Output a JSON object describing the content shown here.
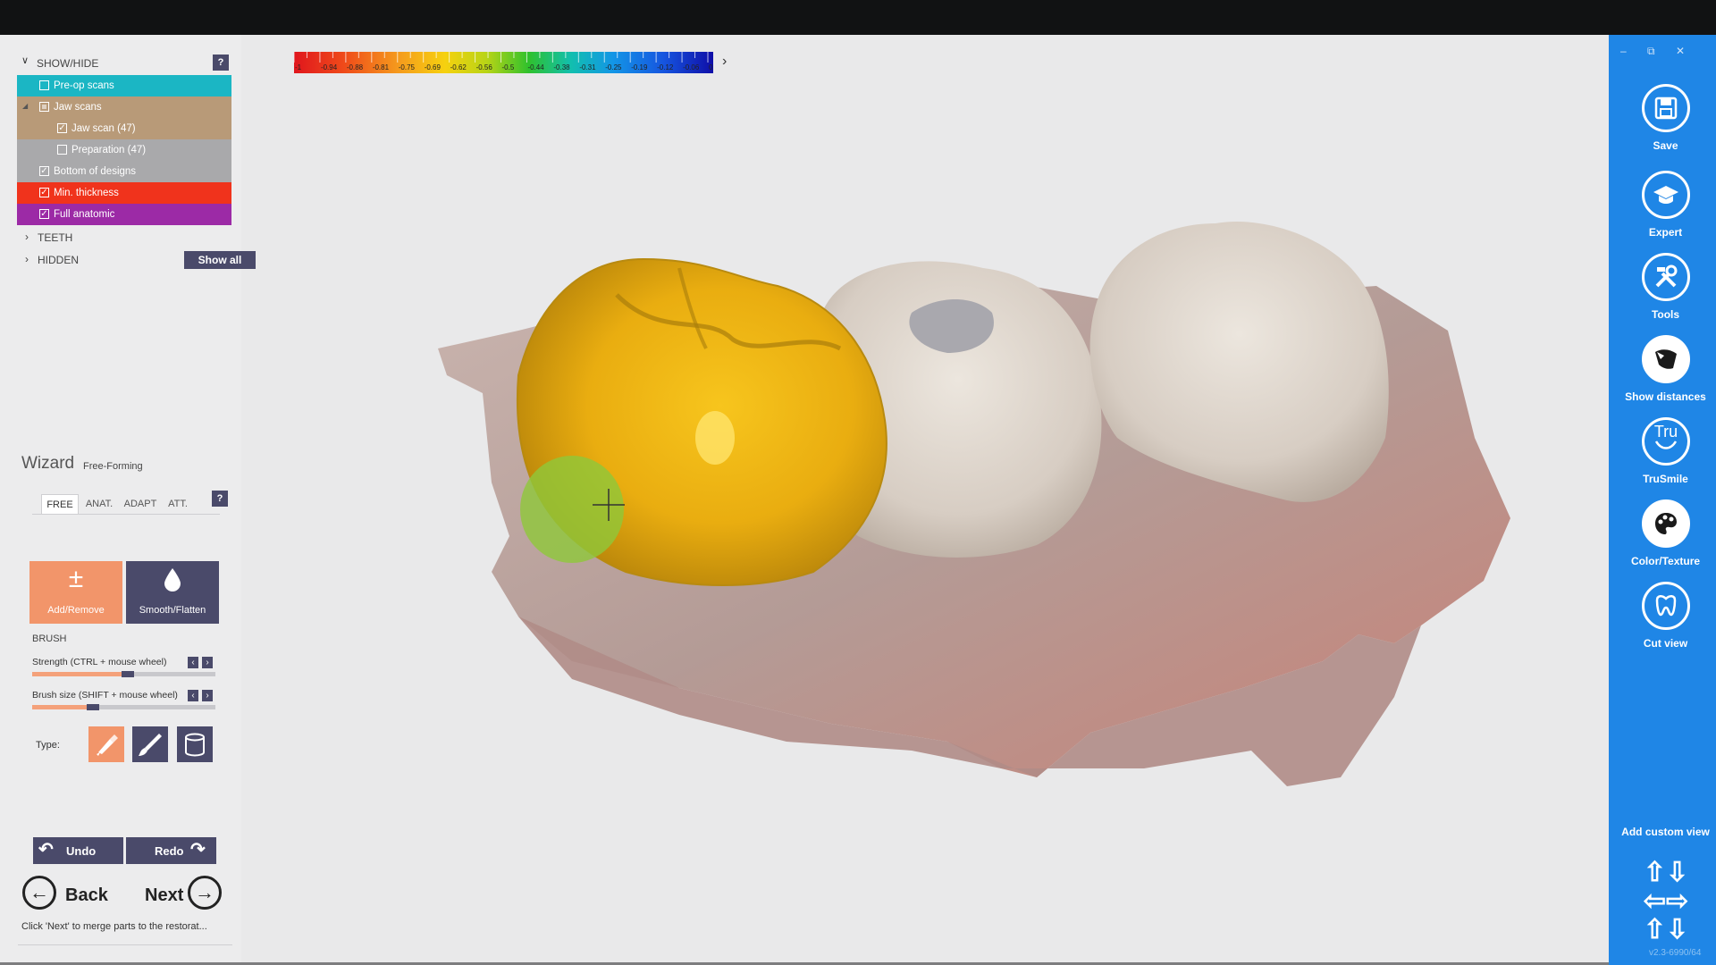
{
  "show_hide": {
    "header": "SHOW/HIDE",
    "help": "?",
    "rows": [
      {
        "label": "Pre-op scans",
        "checked": false,
        "color": "#1bb6c4",
        "indent": 0
      },
      {
        "label": "Jaw scans",
        "checked": false,
        "partial": true,
        "color": "#b89a78",
        "indent": 0,
        "expandable": true
      },
      {
        "label": "Jaw scan (47)",
        "checked": true,
        "color": "#b89a78",
        "indent": 1
      },
      {
        "label": "Preparation (47)",
        "checked": false,
        "color": "#a9a9ab",
        "indent": 1
      },
      {
        "label": "Bottom of designs",
        "checked": true,
        "color": "#a9a9ab",
        "indent": 0
      },
      {
        "label": "Min. thickness",
        "checked": true,
        "color": "#f0331c",
        "indent": 0
      },
      {
        "label": "Full anatomic",
        "checked": true,
        "color": "#9c2aa6",
        "indent": 0
      }
    ],
    "teeth_label": "TEETH",
    "hidden_label": "HIDDEN",
    "show_all": "Show all",
    "check_mark": "✓"
  },
  "wizard": {
    "title": "Wizard",
    "subtitle": "Free-Forming",
    "help": "?",
    "tabs": [
      "FREE",
      "ANAT.",
      "ADAPT",
      "ATT."
    ],
    "active_tab": "FREE",
    "tools": [
      {
        "label": "Add/Remove",
        "icon": "plus-minus-icon",
        "glyph": "±",
        "color": "#f2956a",
        "active": true
      },
      {
        "label": "Smooth/Flatten",
        "icon": "drop-icon",
        "glyph": "💧",
        "color": "#4a4a6a",
        "active": false
      }
    ],
    "brush_label": "BRUSH",
    "strength": {
      "label": "Strength (CTRL + mouse wheel)",
      "value": 0.52
    },
    "brush_size": {
      "label": "Brush size (SHIFT + mouse wheel)",
      "value": 0.33
    },
    "type_label": "Type:",
    "types": [
      {
        "icon": "paint-roller-icon",
        "active": true
      },
      {
        "icon": "brush-icon",
        "active": false
      },
      {
        "icon": "cylinder-icon",
        "active": false
      }
    ],
    "undo": "Undo",
    "redo": "Redo",
    "back": "Back",
    "next": "Next",
    "hint": "Click 'Next' to merge parts to the restorat..."
  },
  "color_scale": {
    "labels": [
      "-1",
      "-0.94",
      "-0.88",
      "-0.81",
      "-0.75",
      "-0.69",
      "-0.62",
      "-0.56",
      "-0.5",
      "-0.44",
      "-0.38",
      "-0.31",
      "-0.25",
      "-0.19",
      "-0.12",
      "-0.06",
      "0"
    ],
    "arrow": "›"
  },
  "sidebar": {
    "window_controls": [
      "–",
      "⧉",
      "✕"
    ],
    "buttons": [
      {
        "label": "Save",
        "icon": "save-icon",
        "glyph": "💾"
      },
      {
        "label": "Expert",
        "icon": "graduation-cap-icon",
        "glyph": "🎓"
      },
      {
        "label": "Tools",
        "icon": "tools-icon",
        "glyph": "⚒"
      },
      {
        "label": "Show distances",
        "icon": "show-distances-icon",
        "glyph": "◣"
      },
      {
        "label": "TruSmile",
        "icon": "trusmile-icon",
        "glyph": "Tru"
      },
      {
        "label": "Color/Texture",
        "icon": "color-texture-icon",
        "glyph": "🎨"
      },
      {
        "label": "Cut view",
        "icon": "cut-view-icon",
        "glyph": "♉"
      }
    ],
    "custom_view": "Add custom view",
    "version": "v2.3-6990/64",
    "colors": {
      "accent": "#1f86e6"
    }
  }
}
